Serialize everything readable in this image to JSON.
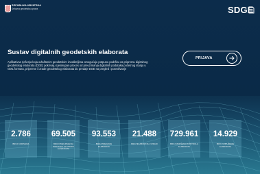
{
  "header": {
    "republic": "REPUBLIKA HRVATSKA",
    "agency": "Državna geodetska uprava",
    "brand": "SDGE"
  },
  "hero": {
    "title": "Sustav digitalnih geodetskih elaborata",
    "description": "Aplikativna rješenja koja ovlaštenim geodetskim izvoditeljima omogućuju potpunu podršku za pripremu digitalnog geodetskog elaborata (DGE) pokrivaju cjelokupan proces od preuzimanja digitalnih podataka početnog stanja u GML formatu, pripreme i izrade geodetskog elaborata do predaje DGE na pregled i potvrđivanje",
    "login_label": "PRIJAVA"
  },
  "stats": [
    {
      "value": "2.786",
      "label": "BROJ KORISNIKA"
    },
    {
      "value": "69.505",
      "label": "BROJ PREUZIMANJA PODATAKA ZA IZRADU ELABORATA"
    },
    {
      "value": "93.553",
      "label": "BROJ PREDANIH ELABORATA"
    },
    {
      "value": "21.488",
      "label": "BROJ ELABORATA U IZRADI"
    },
    {
      "value": "729.961",
      "label": "BROJ IZVRŠENIH KONTROLA ELABORATA"
    },
    {
      "value": "14.929",
      "label": "BROJ UDRUŽENIH ELABORATA"
    }
  ]
}
